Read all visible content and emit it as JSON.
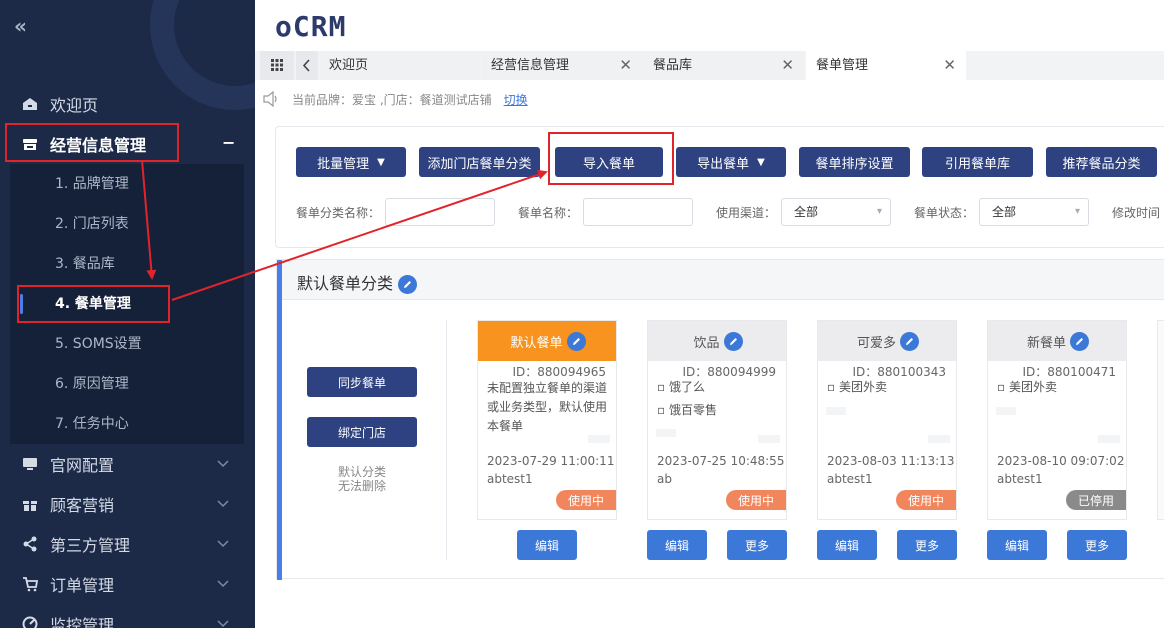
{
  "sidebar": {
    "collapse_icon": "double-chevron-left-icon",
    "menu": [
      {
        "label": "欢迎页",
        "icon": "home-icon"
      },
      {
        "label": "经营信息管理",
        "icon": "store-icon",
        "expanded_sign": "−"
      },
      {
        "label": "官网配置",
        "icon": "monitor-icon"
      },
      {
        "label": "顾客营销",
        "icon": "gift-icon"
      },
      {
        "label": "第三方管理",
        "icon": "share-icon"
      },
      {
        "label": "订单管理",
        "icon": "cart-icon"
      },
      {
        "label": "监控管理",
        "icon": "gauge-icon"
      }
    ],
    "submenu": [
      {
        "label": "1. 品牌管理"
      },
      {
        "label": "2. 门店列表"
      },
      {
        "label": "3. 餐品库"
      },
      {
        "label": "4. 餐单管理",
        "active": true
      },
      {
        "label": "5. SOMS设置"
      },
      {
        "label": "6. 原因管理"
      },
      {
        "label": "7. 任务中心"
      }
    ]
  },
  "header": {
    "logo_text": "oCRM"
  },
  "tabs": {
    "grid_icon": "apps-grid-icon",
    "back_icon": "chevron-left-icon",
    "items": [
      {
        "label": "欢迎页",
        "closable": false
      },
      {
        "label": "经营信息管理",
        "closable": true
      },
      {
        "label": "餐品库",
        "closable": true
      },
      {
        "label": "餐单管理",
        "closable": true,
        "active": true
      }
    ],
    "close_glyph": "✕"
  },
  "notice": {
    "icon": "speaker-icon",
    "text": "当前品牌：爱宝 ,门店：餐道测试店铺",
    "switch_label": "切换"
  },
  "toolbar": {
    "buttons": [
      {
        "label": "批量管理",
        "dropdown": true
      },
      {
        "label": "添加门店餐单分类"
      },
      {
        "label": "导入餐单"
      },
      {
        "label": "导出餐单",
        "dropdown": true
      },
      {
        "label": "餐单排序设置"
      },
      {
        "label": "引用餐单库"
      },
      {
        "label": "推荐餐品分类"
      }
    ]
  },
  "filters": {
    "category_name_label": "餐单分类名称：",
    "category_name_value": "",
    "menu_name_label": "餐单名称：",
    "menu_name_value": "",
    "channel_label": "使用渠道：",
    "channel_value": "全部",
    "status_label": "餐单状态：",
    "status_value": "全部",
    "modified_time_label": "修改时间"
  },
  "category": {
    "title": "默认餐单分类",
    "sync_button": "同步餐单",
    "bind_button": "绑定门店",
    "note_line1": "默认分类",
    "note_line2": "无法删除",
    "cards": [
      {
        "name": "默认餐单",
        "id": "ID：880094965",
        "lines": [
          "未配置独立餐单的渠道或业务类型，默认使用本餐单"
        ],
        "date": "2023-07-29 11:00:11",
        "user": "abtest1",
        "status": "使用中",
        "actions": [
          "编辑"
        ]
      },
      {
        "name": "饮品",
        "id": "ID：880094999",
        "lines": [
          "▫ 饿了么",
          "▫ 饿百零售"
        ],
        "date": "2023-07-25 10:48:55",
        "user": "ab",
        "status": "使用中",
        "actions": [
          "编辑",
          "更多"
        ]
      },
      {
        "name": "可爱多",
        "id": "ID：880100343",
        "lines": [
          "▫ 美团外卖"
        ],
        "date": "2023-08-03 11:13:13",
        "user": "abtest1",
        "status": "使用中",
        "actions": [
          "编辑",
          "更多"
        ]
      },
      {
        "name": "新餐单",
        "id": "ID：880100471",
        "lines": [
          "▫ 美团外卖"
        ],
        "date": "2023-08-10 09:07:02",
        "user": "abtest1",
        "status": "已停用",
        "actions": [
          "编辑",
          "更多"
        ]
      }
    ]
  },
  "colors": {
    "accent": "#2e4180",
    "highlight": "#e0242a",
    "default_card": "#f7931e",
    "in_use": "#f1865c",
    "disabled": "#8a8a8a",
    "link": "#3c78d8"
  }
}
